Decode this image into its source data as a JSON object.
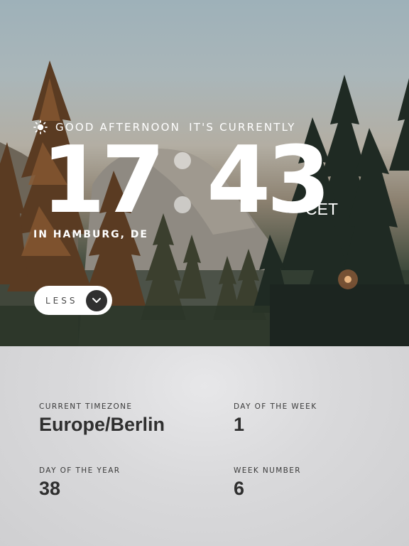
{
  "greeting": {
    "icon": "sun-icon",
    "text": "GOOD AFTERNOON",
    "suffix": "IT'S CURRENTLY"
  },
  "clock": {
    "hours": "17",
    "minutes": "43",
    "timezone_abbr": "CET"
  },
  "location": "IN HAMBURG, DE",
  "toggle": {
    "label": "LESS",
    "icon": "chevron-down-icon"
  },
  "details": {
    "timezone": {
      "label": "CURRENT TIMEZONE",
      "value": "Europe/Berlin"
    },
    "day_of_week": {
      "label": "DAY OF THE WEEK",
      "value": "1"
    },
    "day_of_year": {
      "label": "DAY OF THE YEAR",
      "value": "38"
    },
    "week_number": {
      "label": "WEEK NUMBER",
      "value": "6"
    }
  },
  "colors": {
    "text_on_image": "#ffffff",
    "button_bg": "#ffffff",
    "chevron_bg": "#303030",
    "panel_text": "#2f2f2f"
  }
}
